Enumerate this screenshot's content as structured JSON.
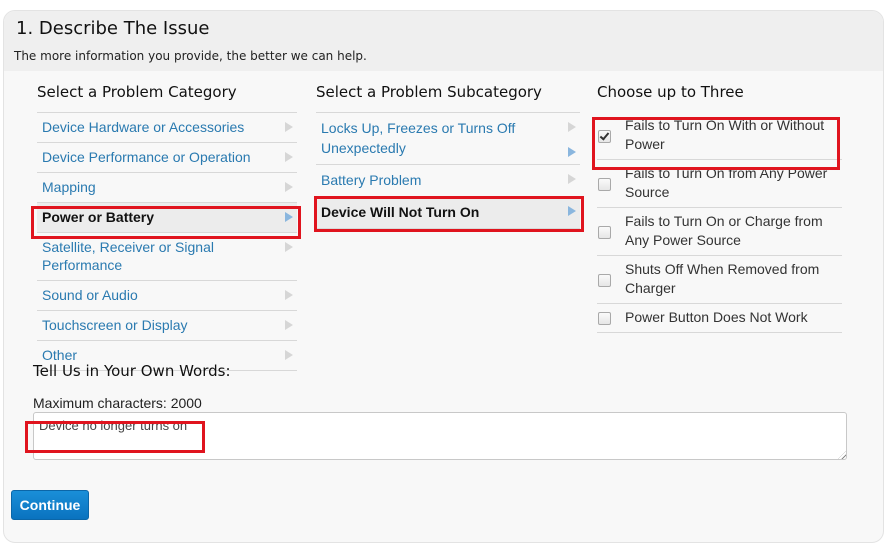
{
  "header": {
    "title": "1. Describe The Issue",
    "subtitle": "The more information you provide, the better we can help."
  },
  "category": {
    "heading": "Select a Problem Category",
    "selected_index": 3,
    "items": [
      {
        "label": "Device Hardware or Accessories"
      },
      {
        "label": "Device Performance or Operation"
      },
      {
        "label": "Mapping"
      },
      {
        "label": "Power or Battery"
      },
      {
        "label": "Satellite, Receiver or Signal Performance"
      },
      {
        "label": "Sound or Audio"
      },
      {
        "label": "Touchscreen or Display"
      },
      {
        "label": "Other"
      }
    ]
  },
  "subcategory": {
    "heading": "Select a Problem Subcategory",
    "selected_index": 2,
    "items": [
      {
        "label": "Locks Up, Freezes or Turns Off Unexpectedly"
      },
      {
        "label": "Battery Problem"
      },
      {
        "label": "Device Will Not Turn On"
      }
    ]
  },
  "choices": {
    "heading": "Choose up to Three",
    "items": [
      {
        "label": "Fails to Turn On With or Without Power",
        "checked": true
      },
      {
        "label": "Fails to Turn On from Any Power Source",
        "checked": false
      },
      {
        "label": "Fails to Turn On or Charge from Any Power Source",
        "checked": false
      },
      {
        "label": "Shuts Off When Removed from Charger",
        "checked": false
      },
      {
        "label": "Power Button Does Not Work",
        "checked": false
      }
    ]
  },
  "own_words": {
    "heading": "Tell Us in Your Own Words:",
    "max_chars_label": "Maximum characters: 2000",
    "value": "Device no longer turns on"
  },
  "actions": {
    "continue_label": "Continue"
  },
  "colors": {
    "link": "#2a7ab0",
    "highlight": "#e0141e",
    "button": "#0a73bf"
  }
}
